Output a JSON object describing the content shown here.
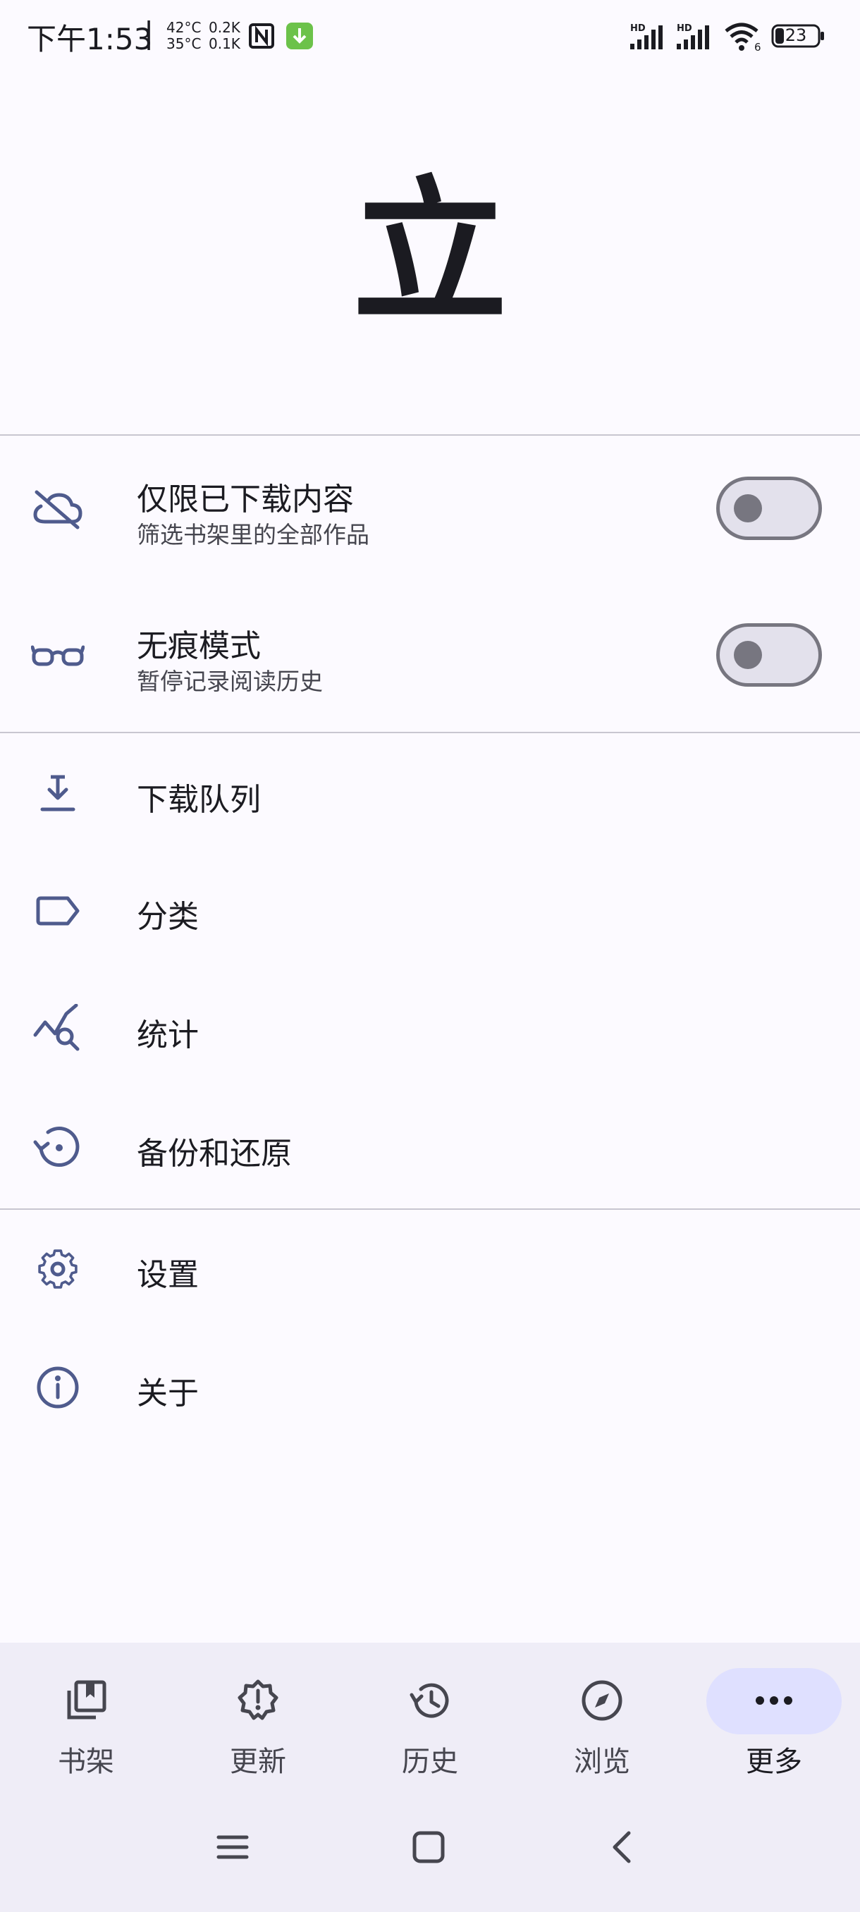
{
  "status_bar": {
    "time": "下午1:53",
    "separator": "|",
    "temp_top": "42°C",
    "temp_bottom": "35°C",
    "speed_top": "0.2K",
    "speed_bottom": "0.1K",
    "hd1": "HD",
    "hd2": "HD",
    "wifi_badge": "6",
    "battery": "23"
  },
  "logo": {
    "glyph": "立"
  },
  "toggles": [
    {
      "title": "仅限已下载内容",
      "subtitle": "筛选书架里的全部作品",
      "icon": "cloud-off-icon",
      "on": false
    },
    {
      "title": "无痕模式",
      "subtitle": "暂停记录阅读历史",
      "icon": "glasses-icon",
      "on": false
    }
  ],
  "menu": [
    {
      "label": "下载队列",
      "icon": "download-icon"
    },
    {
      "label": "分类",
      "icon": "label-icon"
    },
    {
      "label": "统计",
      "icon": "stats-search-icon"
    },
    {
      "label": "备份和还原",
      "icon": "backup-restore-icon"
    }
  ],
  "menu2": [
    {
      "label": "设置",
      "icon": "gear-icon"
    },
    {
      "label": "关于",
      "icon": "info-icon"
    }
  ],
  "bottom_nav": {
    "items": [
      {
        "label": "书架",
        "icon": "library-icon"
      },
      {
        "label": "更新",
        "icon": "updates-alert-icon"
      },
      {
        "label": "历史",
        "icon": "history-icon"
      },
      {
        "label": "浏览",
        "icon": "compass-icon"
      },
      {
        "label": "更多",
        "icon": "more-horizontal-icon"
      }
    ],
    "active_index": 4
  },
  "colors": {
    "icon": "#4f5b8d",
    "active_pill": "#dfe0ff",
    "nav_bg": "#efedf7",
    "bg": "#fcfaff"
  }
}
